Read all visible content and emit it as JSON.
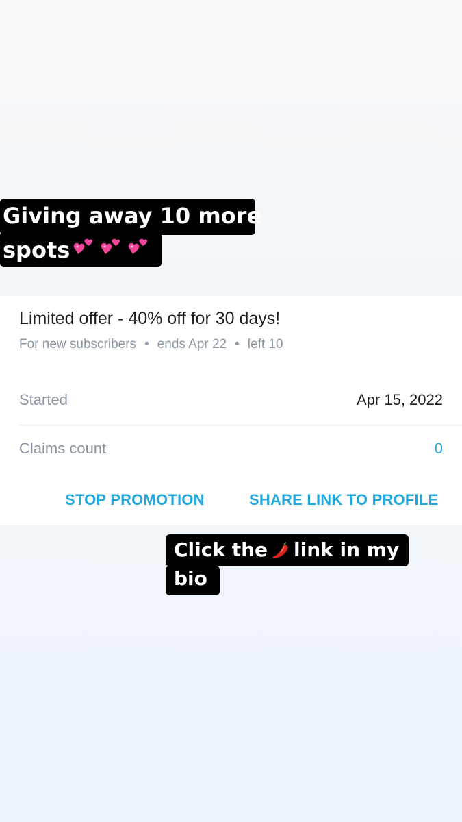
{
  "captions": {
    "top": {
      "line1": "Giving away 10 more",
      "line2": "spots"
    },
    "bottom": {
      "line1_before": "Click the",
      "line1_after": "link in my",
      "line2": "bio"
    }
  },
  "icons": {
    "hearts": "two-hearts-emoji",
    "chili": "hot-pepper-emoji"
  },
  "promotion": {
    "title": "Limited offer - 40% off for 30 days!",
    "audience": "For new subscribers",
    "ends": "ends Apr 22",
    "left": "left 10",
    "started_label": "Started",
    "started_value": "Apr 15, 2022",
    "claims_label": "Claims count",
    "claims_value": "0",
    "stop_label": "STOP PROMOTION",
    "share_label": "SHARE LINK TO PROFILE"
  },
  "colors": {
    "accent": "#22a8df",
    "muted_text": "#8a96a3",
    "caption_bg": "#000000",
    "heart_pink": "#f0479a",
    "chili_red": "#d8241c"
  }
}
